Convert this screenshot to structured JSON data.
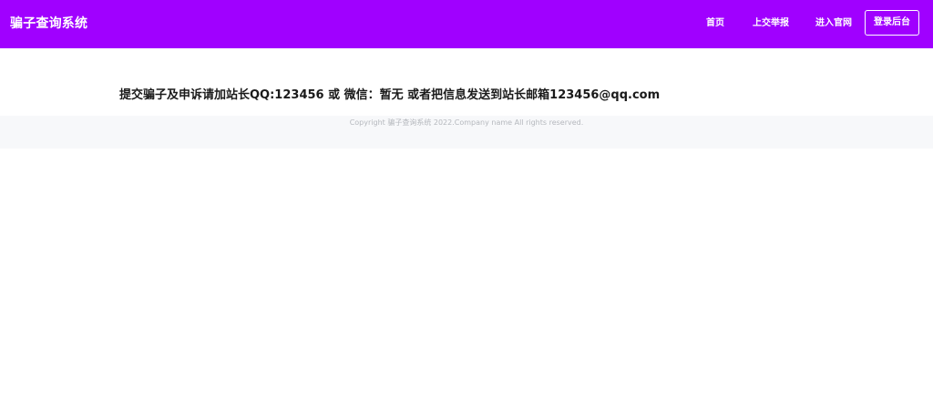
{
  "colors": {
    "accent": "#a000ff"
  },
  "header": {
    "brand": "骗子查询系统",
    "nav": {
      "home": "首页",
      "report": "上交举报",
      "site": "进入官网"
    },
    "login_label": "登录后台"
  },
  "main": {
    "notice": "提交骗子及申诉请加站长QQ:123456 或 微信：暂无 或者把信息发送到站长邮箱123456@qq.com"
  },
  "footer": {
    "copyright": "Copyright 骗子查询系统 2022.Company name All rights reserved."
  }
}
